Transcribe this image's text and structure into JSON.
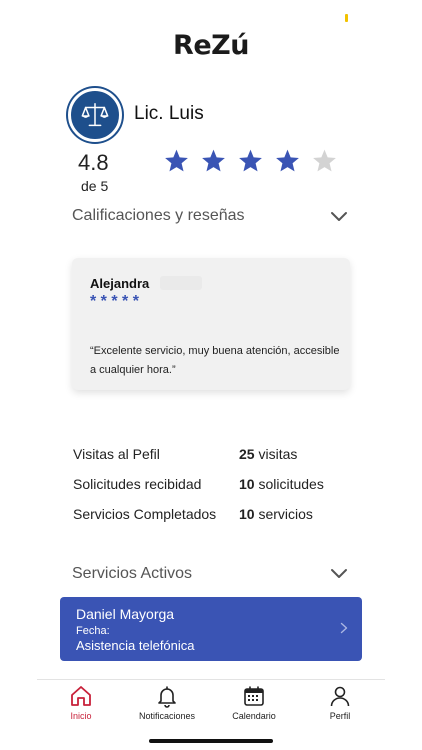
{
  "app": {
    "logo_main": "ReZ",
    "logo_u": "ú"
  },
  "profile": {
    "name": "Lic. Luis",
    "rating": "4.8",
    "rating_of": "de 5",
    "stars_filled": 4,
    "stars_total": 5,
    "avatar_icon": "scales-of-justice-icon"
  },
  "reviews_section": {
    "title": "Calificaciones y reseñas",
    "review": {
      "author": "Alejandra",
      "stars": "* * * * *",
      "text": "“Excelente servicio, muy buena atención, accesible a cualquier hora.”"
    }
  },
  "stats": [
    {
      "label": "Visitas al Pefil",
      "count": "25",
      "unit": "visitas"
    },
    {
      "label": "Solicitudes recibidad",
      "count": "10",
      "unit": "solicitudes"
    },
    {
      "label": "Servicios Completados",
      "count": "10",
      "unit": "servicios"
    }
  ],
  "active_services": {
    "title": "Servicios Activos",
    "item": {
      "client": "Daniel Mayorga",
      "date_label": "Fecha:",
      "service": "Asistencia telefónica"
    }
  },
  "tabbar": [
    {
      "label": "Inicio",
      "icon": "home-icon",
      "active": true
    },
    {
      "label": "Notificaciones",
      "icon": "bell-icon",
      "active": false
    },
    {
      "label": "Calendario",
      "icon": "calendar-icon",
      "active": false
    },
    {
      "label": "Perfil",
      "icon": "user-icon",
      "active": false
    }
  ],
  "colors": {
    "accent": "#3a54b4",
    "active_tab": "#c8213a",
    "star_empty": "#d3d3d3",
    "avatar_bg": "#1e4f8c"
  }
}
